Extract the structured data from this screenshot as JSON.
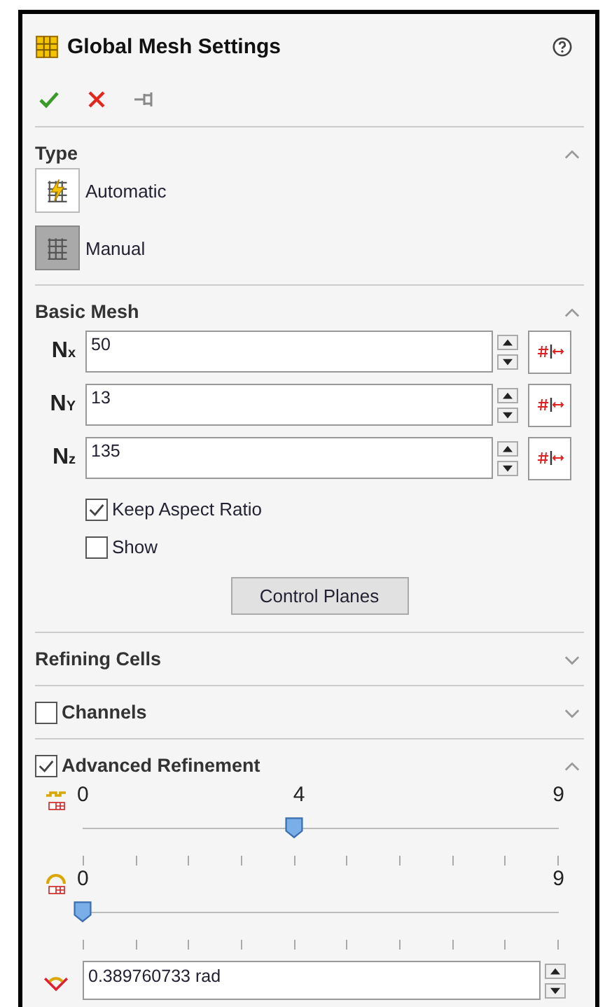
{
  "title": "Global Mesh Settings",
  "sections": [
    {
      "kind": "type",
      "title": "Type",
      "expanded": true,
      "options": [
        {
          "label": "Automatic",
          "selected": false
        },
        {
          "label": "Manual",
          "selected": true
        }
      ]
    },
    {
      "kind": "basic",
      "title": "Basic Mesh",
      "expanded": true,
      "counts": [
        {
          "label": "N",
          "sub": "x",
          "value": "50"
        },
        {
          "label": "N",
          "sub": "Y",
          "value": "13"
        },
        {
          "label": "N",
          "sub": "z",
          "value": "135"
        }
      ],
      "checkboxes": [
        {
          "label": "Keep Aspect Ratio",
          "checked": true
        },
        {
          "label": "Show",
          "checked": false
        }
      ],
      "button": "Control Planes"
    },
    {
      "kind": "plain",
      "title": "Refining Cells",
      "expanded": false
    },
    {
      "kind": "check",
      "title": "Channels",
      "checked": false,
      "expanded": false
    },
    {
      "kind": "advanced",
      "title": "Advanced Refinement",
      "checked": true,
      "expanded": true,
      "sliders": [
        {
          "min": "0",
          "value": "4",
          "max": "9",
          "level": 0.444
        },
        {
          "min": "0",
          "max": "9",
          "level": 0
        }
      ],
      "angle": "0.389760733 rad"
    }
  ]
}
